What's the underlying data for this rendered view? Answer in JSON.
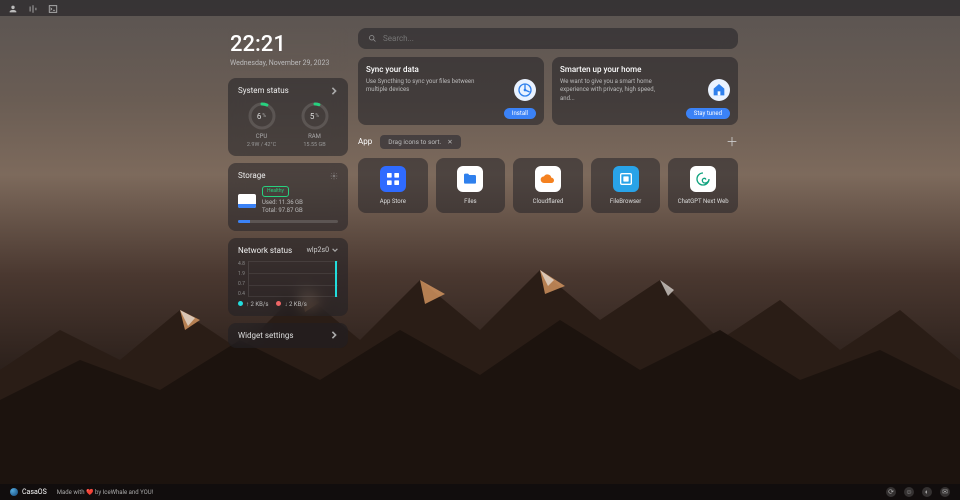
{
  "clock": {
    "time": "22:21",
    "date": "Wednesday, November 29, 2023"
  },
  "system": {
    "title": "System status",
    "cpu": {
      "percent": "6",
      "label": "CPU",
      "sub": "2.9W / 42°C"
    },
    "ram": {
      "percent": "5",
      "label": "RAM",
      "sub": "15.55 GB"
    }
  },
  "storage": {
    "title": "Storage",
    "badge": "Healthy",
    "used": "Used: 11.36 GB",
    "total": "Total: 97.87 GB"
  },
  "network": {
    "title": "Network status",
    "iface": "wlp2s0",
    "ticks": [
      "4.8",
      "1.9",
      "0.7",
      "0.4"
    ],
    "up": "2 KB/s",
    "down": "2 KB/s"
  },
  "widget": {
    "label": "Widget settings"
  },
  "search": {
    "placeholder": "Search..."
  },
  "promos": [
    {
      "title": "Sync your data",
      "desc": "Use Syncthing to sync your files between multiple devices",
      "btn": "Install",
      "icon_bg": "#e9f2ff",
      "icon_fg": "#2f80ed"
    },
    {
      "title": "Smarten up your home",
      "desc": "We want to give you a smart home experience with privacy, high speed, and...",
      "btn": "Stay tuned",
      "icon_bg": "#e9f2ff",
      "icon_fg": "#2f80ed"
    }
  ],
  "app_section": {
    "title": "App",
    "hint": "Drag icons to sort."
  },
  "apps": [
    {
      "name": "App Store",
      "bg": "#2f6bff",
      "fg": "#fff",
      "glyph": "grid"
    },
    {
      "name": "Files",
      "bg": "#ffffff",
      "fg": "#2f80ed",
      "glyph": "folder"
    },
    {
      "name": "Cloudflared",
      "bg": "#ffffff",
      "fg": "#f48120",
      "glyph": "cloud"
    },
    {
      "name": "FileBrowser",
      "bg": "#29a3e8",
      "fg": "#fff",
      "glyph": "box"
    },
    {
      "name": "ChatGPT Next Web",
      "bg": "#ffffff",
      "fg": "#10a37f",
      "glyph": "swirl"
    }
  ],
  "footer": {
    "brand": "CasaOS",
    "credit": "Made with ❤️ by IceWhale and YOU!"
  }
}
